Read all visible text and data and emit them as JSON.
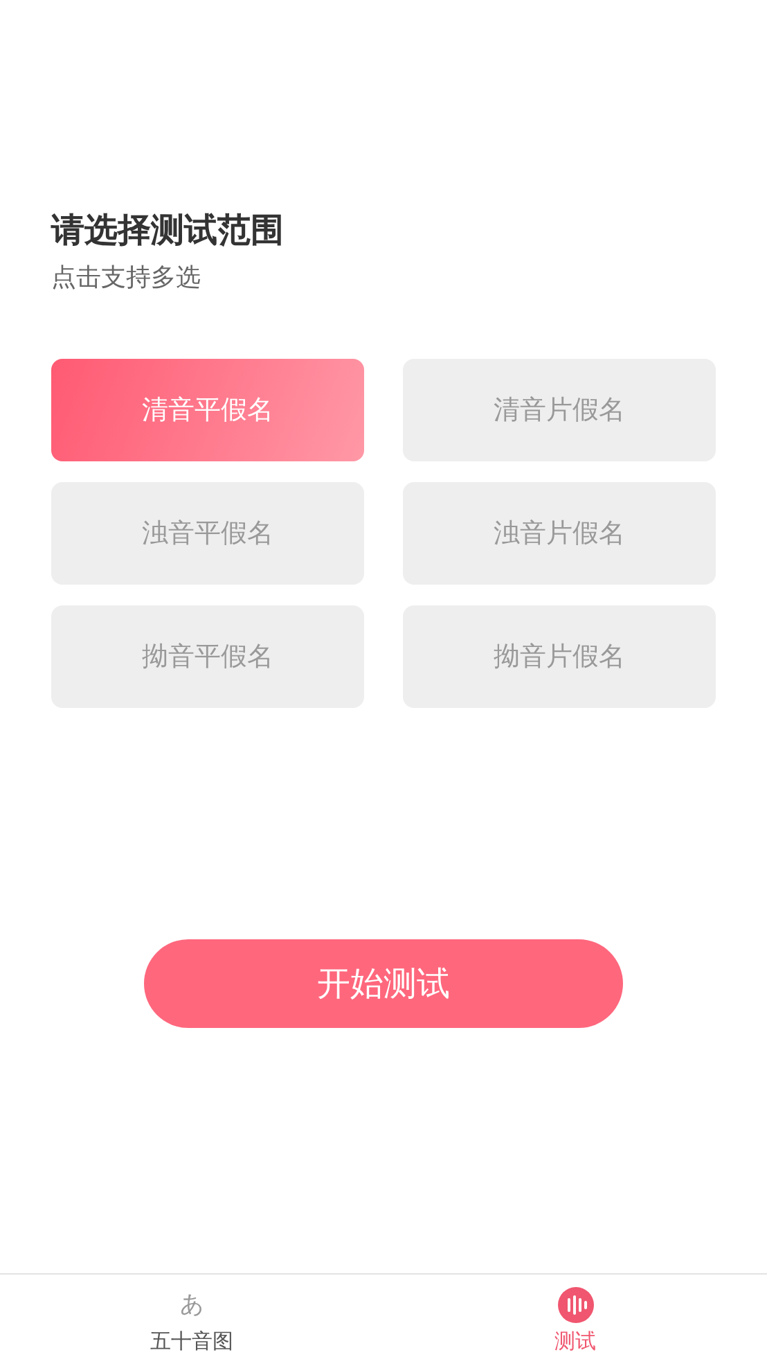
{
  "heading": {
    "title": "请选择测试范围",
    "subtitle": "点击支持多选"
  },
  "options": [
    {
      "label": "清音平假名",
      "selected": true
    },
    {
      "label": "清音片假名",
      "selected": false
    },
    {
      "label": "浊音平假名",
      "selected": false
    },
    {
      "label": "浊音片假名",
      "selected": false
    },
    {
      "label": "拗音平假名",
      "selected": false
    },
    {
      "label": "拗音片假名",
      "selected": false
    }
  ],
  "start_button": "开始测试",
  "tab_bar": [
    {
      "kind": "glyph",
      "glyph": "あ",
      "label": "五十音图",
      "selected": false
    },
    {
      "kind": "wave",
      "label": "测试",
      "selected": true
    }
  ]
}
